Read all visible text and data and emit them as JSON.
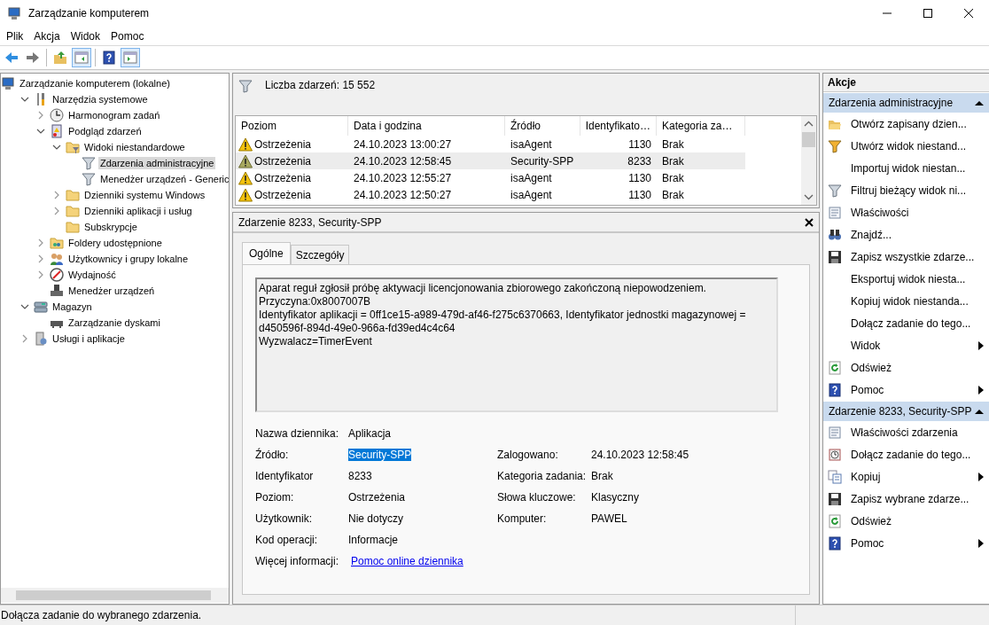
{
  "window": {
    "title": "Zarządzanie komputerem"
  },
  "menu": [
    "Plik",
    "Akcja",
    "Widok",
    "Pomoc"
  ],
  "toolbar": [
    {
      "kind": "back",
      "pressed": false
    },
    {
      "kind": "forward",
      "pressed": false
    },
    {
      "kind": "up",
      "pressed": false
    },
    {
      "kind": "tree",
      "pressed": true
    },
    {
      "kind": "help",
      "pressed": false
    },
    {
      "kind": "actions",
      "pressed": true
    }
  ],
  "tree": [
    {
      "label": "Zarządzanie komputerem (lokalne)",
      "kind": "computer",
      "selected": false,
      "children": [
        {
          "label": "Narzędzia systemowe",
          "kind": "tools",
          "expanded": true,
          "selected": false,
          "children": [
            {
              "label": "Harmonogram zadań",
              "kind": "clock",
              "expanded": false,
              "selected": false
            },
            {
              "label": "Podgląd zdarzeń",
              "kind": "eventlog",
              "expanded": true,
              "selected": false,
              "children": [
                {
                  "label": "Widoki niestandardowe",
                  "kind": "folder-filter",
                  "expanded": true,
                  "selected": false,
                  "children": [
                    {
                      "label": "Zdarzenia administracyjne",
                      "kind": "filter",
                      "selected": true
                    },
                    {
                      "label": "Menedżer urządzeń - Generic",
                      "kind": "filter",
                      "selected": false
                    }
                  ]
                },
                {
                  "label": "Dzienniki systemu Windows",
                  "kind": "folder",
                  "expanded": false,
                  "selected": false
                },
                {
                  "label": "Dzienniki aplikacji i usług",
                  "kind": "folder",
                  "expanded": false,
                  "selected": false
                },
                {
                  "label": "Subskrypcje",
                  "kind": "folder",
                  "selected": false
                }
              ]
            },
            {
              "label": "Foldery udostępnione",
              "kind": "share",
              "expanded": false,
              "selected": false
            },
            {
              "label": "Użytkownicy i grupy lokalne",
              "kind": "users",
              "expanded": false,
              "selected": false
            },
            {
              "label": "Wydajność",
              "kind": "perf",
              "expanded": false,
              "selected": false
            },
            {
              "label": "Menedżer urządzeń",
              "kind": "device",
              "selected": false
            }
          ]
        },
        {
          "label": "Magazyn",
          "kind": "storage",
          "expanded": true,
          "selected": false,
          "children": [
            {
              "label": "Zarządzanie dyskami",
              "kind": "disk",
              "selected": false
            }
          ]
        },
        {
          "label": "Usługi i aplikacje",
          "kind": "services",
          "expanded": false,
          "selected": false
        }
      ]
    }
  ],
  "events": {
    "count_label": "Liczba zdarzeń: 15 552",
    "columns": [
      "Poziom",
      "Data i godzina",
      "Źródło",
      "Identyfikato…",
      "Kategoria za…"
    ],
    "rows": [
      {
        "level": "Ostrzeżenia",
        "date": "24.10.2023 13:00:27",
        "source": "isaAgent",
        "id": "1130",
        "category": "Brak",
        "selected": false
      },
      {
        "level": "Ostrzeżenia",
        "date": "24.10.2023 12:58:45",
        "source": "Security-SPP",
        "id": "8233",
        "category": "Brak",
        "selected": true
      },
      {
        "level": "Ostrzeżenia",
        "date": "24.10.2023 12:55:27",
        "source": "isaAgent",
        "id": "1130",
        "category": "Brak",
        "selected": false
      },
      {
        "level": "Ostrzeżenia",
        "date": "24.10.2023 12:50:27",
        "source": "isaAgent",
        "id": "1130",
        "category": "Brak",
        "selected": false
      }
    ]
  },
  "detail": {
    "title": "Zdarzenie 8233, Security-SPP",
    "tabs": [
      {
        "label": "Ogólne",
        "selected": true
      },
      {
        "label": "Szczegóły",
        "selected": false
      }
    ],
    "description": "Aparat reguł zgłosił próbę aktywacji licencjonowania zbiorowego zakończoną niepowodzeniem.\nPrzyczyna:0x8007007B\nIdentyfikator aplikacji = 0ff1ce15-a989-479d-af46-f275c6370663, Identyfikator jednostki magazynowej = d450596f-894d-49e0-966a-fd39ed4c4c64\nWyzwalacz=TimerEvent",
    "fields": [
      {
        "label": "Nazwa dziennika:",
        "value": "Aplikacja",
        "kind": "text",
        "selected": false
      },
      {
        "label": "Źródło:",
        "value": "Security-SPP",
        "kind": "text",
        "selected": true
      },
      {
        "label": "Identyfikator",
        "value": "8233",
        "kind": "text",
        "selected": false
      },
      {
        "label": "Poziom:",
        "value": "Ostrzeżenia",
        "kind": "text",
        "selected": false
      },
      {
        "label": "Użytkownik:",
        "value": "Nie dotyczy",
        "kind": "text",
        "selected": false
      },
      {
        "label": "Kod operacji:",
        "value": "Informacje",
        "kind": "text",
        "selected": false
      },
      {
        "label": "Więcej informacji:",
        "value": "Pomoc online dziennika",
        "kind": "link",
        "selected": false
      }
    ],
    "fields_right": [
      {
        "label": "Zalogowano:",
        "value": "24.10.2023 12:58:45",
        "selected": false
      },
      {
        "label": "Kategoria zadania:",
        "value": "Brak",
        "selected": false
      },
      {
        "label": "Słowa kluczowe:",
        "value": "Klasyczny",
        "selected": false
      },
      {
        "label": "Komputer:",
        "value": "PAWEL",
        "selected": false
      }
    ]
  },
  "actions": {
    "title": "Akcje",
    "sections": [
      {
        "title": "Zdarzenia administracyjne",
        "expanded": true,
        "items": [
          {
            "label": "Otwórz zapisany dzien...",
            "kind": "open",
            "submenu": false
          },
          {
            "label": "Utwórz widok niestand...",
            "kind": "filter-new",
            "submenu": false
          },
          {
            "label": "Importuj widok niestan...",
            "kind": "none",
            "submenu": false
          },
          {
            "label": "Filtruj bieżący widok ni...",
            "kind": "filter",
            "submenu": false
          },
          {
            "label": "Właściwości",
            "kind": "props",
            "submenu": false
          },
          {
            "label": "Znajdź...",
            "kind": "find",
            "submenu": false
          },
          {
            "label": "Zapisz wszystkie zdarze...",
            "kind": "save",
            "submenu": false
          },
          {
            "label": "Eksportuj widok niesta...",
            "kind": "none",
            "submenu": false
          },
          {
            "label": "Kopiuj widok niestanda...",
            "kind": "none",
            "submenu": false
          },
          {
            "label": "Dołącz zadanie do tego...",
            "kind": "none",
            "submenu": false
          },
          {
            "label": "Widok",
            "kind": "none",
            "submenu": true
          },
          {
            "label": "Odśwież",
            "kind": "refresh",
            "submenu": false
          },
          {
            "label": "Pomoc",
            "kind": "help",
            "submenu": true
          }
        ]
      },
      {
        "title": "Zdarzenie 8233, Security-SPP",
        "expanded": true,
        "items": [
          {
            "label": "Właściwości zdarzenia",
            "kind": "props",
            "submenu": false
          },
          {
            "label": "Dołącz zadanie do tego...",
            "kind": "task",
            "submenu": false
          },
          {
            "label": "Kopiuj",
            "kind": "copy",
            "submenu": true
          },
          {
            "label": "Zapisz wybrane zdarze...",
            "kind": "save",
            "submenu": false
          },
          {
            "label": "Odśwież",
            "kind": "refresh",
            "submenu": false
          },
          {
            "label": "Pomoc",
            "kind": "help",
            "submenu": true
          }
        ]
      }
    ]
  },
  "status_bar": "Dołącza zadanie do wybranego zdarzenia."
}
